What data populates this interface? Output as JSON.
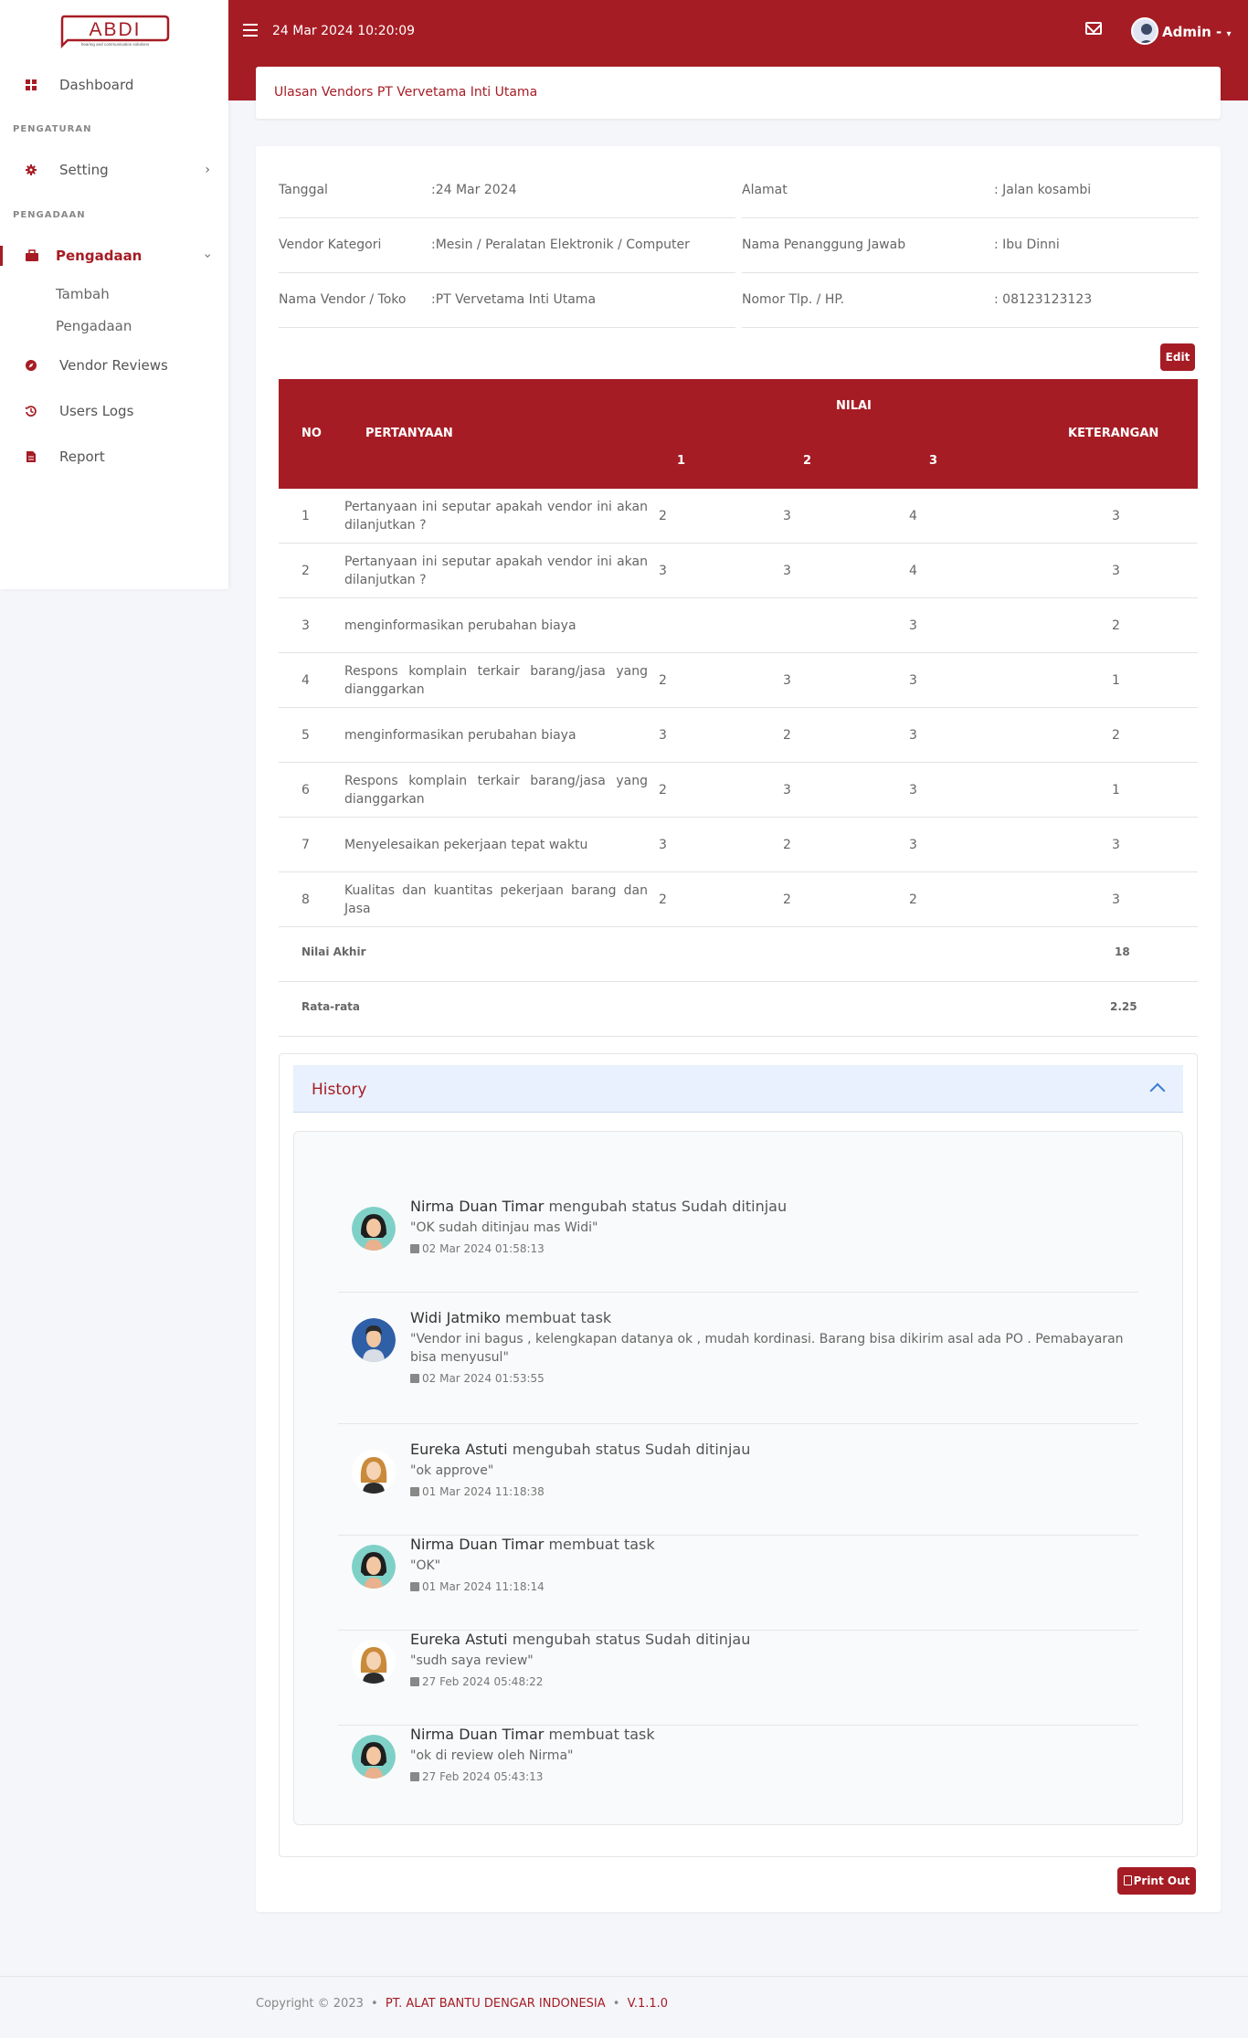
{
  "app": {
    "logo_text": "ABDI",
    "logo_tagline": "hearing and communication solutions"
  },
  "sidebar": {
    "dashboard": "Dashboard",
    "section_pengaturan": "PENGATURAN",
    "setting": "Setting",
    "section_pengadaan": "PENGADAAN",
    "pengadaan": "Pengadaan",
    "sub_tambah": "Tambah",
    "sub_pengadaan": "Pengadaan",
    "vendor_reviews": "Vendor Reviews",
    "users_logs": "Users Logs",
    "report": "Report"
  },
  "topbar": {
    "datetime": "24 Mar 2024 10:20:09",
    "user": "Admin -"
  },
  "breadcrumb": "Ulasan Vendors PT Vervetama Inti Utama",
  "info": {
    "tanggal_label": "Tanggal",
    "tanggal_value": ":24 Mar 2024",
    "vendor_kategori_label": "Vendor Kategori",
    "vendor_kategori_value": ":Mesin / Peralatan Elektronik / Computer",
    "nama_vendor_label": "Nama Vendor / Toko",
    "nama_vendor_value": ":PT Vervetama Inti Utama",
    "alamat_label": "Alamat",
    "alamat_value": ": Jalan kosambi",
    "penanggung_label": "Nama Penanggung Jawab",
    "penanggung_value": ": Ibu Dinni",
    "telp_label": "Nomor Tlp. / HP.",
    "telp_value": ": 08123123123"
  },
  "buttons": {
    "edit": "Edit",
    "print": "Print Out"
  },
  "table": {
    "headers": {
      "no": "NO",
      "pertanyaan": "PERTANYAAN",
      "nilai": "NILAI",
      "n1": "1",
      "n2": "2",
      "n3": "3",
      "keterangan": "KETERANGAN"
    },
    "rows": [
      {
        "no": "1",
        "q": "Pertanyaan ini seputar apakah vendor ini akan dilanjutkan ?",
        "v1": "2",
        "v2": "3",
        "v3": "4",
        "k": "3"
      },
      {
        "no": "2",
        "q": "Pertanyaan ini seputar apakah vendor ini akan dilanjutkan ?",
        "v1": "3",
        "v2": "3",
        "v3": "4",
        "k": "3"
      },
      {
        "no": "3",
        "q": "menginformasikan perubahan biaya",
        "v1": "",
        "v2": "",
        "v3": "3",
        "k": "2"
      },
      {
        "no": "4",
        "q": "Respons komplain terkair barang/jasa yang dianggarkan",
        "v1": "2",
        "v2": "3",
        "v3": "3",
        "k": "1"
      },
      {
        "no": "5",
        "q": "menginformasikan perubahan biaya",
        "v1": "3",
        "v2": "2",
        "v3": "3",
        "k": "2"
      },
      {
        "no": "6",
        "q": "Respons komplain terkair barang/jasa yang dianggarkan",
        "v1": "2",
        "v2": "3",
        "v3": "3",
        "k": "1"
      },
      {
        "no": "7",
        "q": "Menyelesaikan pekerjaan tepat waktu",
        "v1": "3",
        "v2": "2",
        "v3": "3",
        "k": "3"
      },
      {
        "no": "8",
        "q": "Kualitas dan kuantitas pekerjaan barang dan Jasa",
        "v1": "2",
        "v2": "2",
        "v3": "2",
        "k": "3"
      }
    ],
    "nilai_akhir_label": "Nilai Akhir",
    "nilai_akhir_value": "18",
    "rata_label": "Rata-rata",
    "rata_value": "2.25"
  },
  "history": {
    "title": "History",
    "entries": [
      {
        "name": "Nirma Duan Timar",
        "action": " mengubah status Sudah ditinjau",
        "note": "\"OK sudah ditinjau mas Widi\"",
        "date": "02 Mar 2024 01:58:13",
        "avatar": "female-dark"
      },
      {
        "name": "Widi Jatmiko",
        "action": " membuat task",
        "note": "\"Vendor ini bagus , kelengkapan datanya ok , mudah kordinasi. Barang bisa dikirim asal ada PO . Pemabayaran bisa menyusul\"",
        "date": "02 Mar 2024 01:53:55",
        "avatar": "male"
      },
      {
        "name": "Eureka Astuti",
        "action": " mengubah status Sudah ditinjau",
        "note": "\"ok approve\"",
        "date": "01 Mar 2024 11:18:38",
        "avatar": "female-blonde"
      },
      {
        "name": "Nirma Duan Timar",
        "action": " membuat task",
        "note": "\"OK\"",
        "date": "01 Mar 2024 11:18:14",
        "avatar": "female-dark"
      },
      {
        "name": "Eureka Astuti",
        "action": " mengubah status Sudah ditinjau",
        "note": "\"sudh saya review\"",
        "date": "27 Feb 2024 05:48:22",
        "avatar": "female-blonde"
      },
      {
        "name": "Nirma Duan Timar",
        "action": " membuat task",
        "note": "\"ok di review oleh Nirma\"",
        "date": "27 Feb 2024 05:43:13",
        "avatar": "female-dark"
      }
    ]
  },
  "footer": {
    "copyright": "Copyright © 2023",
    "sep1": "•",
    "company": "PT. ALAT BANTU DENGAR INDONESIA",
    "sep2": "•",
    "version": "V.1.1.0"
  },
  "colors": {
    "brand": "#a61c24",
    "background": "#f5f6fa",
    "history_header": "#e8f1fd"
  }
}
